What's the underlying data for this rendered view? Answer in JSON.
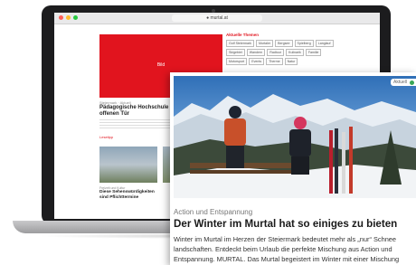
{
  "browser": {
    "url": "● murtal.at"
  },
  "website": {
    "hero_label": "Bild",
    "sidebar_title": "Aktuelle Themen",
    "tags": [
      "Golf Steiermark",
      "Murtaler",
      "Bergsee",
      "Spielberg",
      "Langlauf",
      "Skigebiet",
      "Wandern",
      "Radtour",
      "Kulinarik",
      "Familie",
      "Motorsport",
      "Events",
      "Therme",
      "Natur"
    ],
    "article_kicker": "Steiermark · Aktuell",
    "article_headline": "Pädagogische Hochschule Steiermark: Tag der offenen Tür",
    "more_link": "Lesetipp",
    "thumb_kicker": "Freizeit und Kultur",
    "thumb_headline": "Diese Sehenswürdigkeiten sind Pflichttermine"
  },
  "card": {
    "badge": "Aktuell",
    "kicker": "Action und Entspannung",
    "headline": "Der Winter im Murtal hat so einiges zu bieten",
    "body_line1": "Winter im Murtal im Herzen der Steiermark bedeutet mehr als „nur“ Schnee",
    "body_line2": "landschaften. Entdeckt beim Urlaub die perfekte Mischung aus Action und",
    "body_line3": "Entspannung. MURTAL. Das Murtal begeistert im Winter mit einer Mischung"
  },
  "colors": {
    "brand_red": "#e1141e"
  }
}
